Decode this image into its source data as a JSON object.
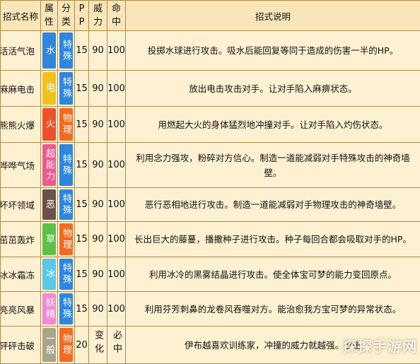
{
  "headers": {
    "name": "招式名称",
    "type": [
      "属",
      "性"
    ],
    "cat": [
      "分",
      "类"
    ],
    "pp": [
      "P",
      "P"
    ],
    "power": [
      "威",
      "力"
    ],
    "acc": [
      "命",
      "中"
    ],
    "desc": "招式说明"
  },
  "rows": [
    {
      "name": "活活气泡",
      "type": "水",
      "cat": "特殊",
      "pp": "15",
      "power": "90",
      "acc": "100",
      "desc": "投掷水球进行攻击。吸水后能回复等同于造成的伤害一半的HP。"
    },
    {
      "name": "麻麻电击",
      "type": "电",
      "cat": "特殊",
      "pp": "15",
      "power": "90",
      "acc": "100",
      "desc": "放出电击攻击对手。让对手陷入麻痹状态。"
    },
    {
      "name": "熊熊火爆",
      "type": "火",
      "cat": "物理",
      "pp": "15",
      "power": "90",
      "acc": "100",
      "desc": "用燃起大火的身体猛烈地冲撞对手。让对手陷入灼伤状态。"
    },
    {
      "name": "哗哗气场",
      "type": "超能力",
      "cat": "特殊",
      "pp": "15",
      "power": "90",
      "acc": "100",
      "desc": "利用念力强攻，粉碎对方信心。制造一道能减弱对手特殊攻击的神奇墙壁。"
    },
    {
      "name": "坏坏领域",
      "type": "恶",
      "cat": "特殊",
      "pp": "15",
      "power": "90",
      "acc": "100",
      "desc": "恶行恶相地进行攻击。制造一道能减弱对手物理攻击的神奇墙壁。"
    },
    {
      "name": "茁茁轰炸",
      "type": "草",
      "cat": "物理",
      "pp": "15",
      "power": "90",
      "acc": "100",
      "desc": "长出巨大的藤蔓，播撒种子进行攻击。种子每回合都会吸取对手的HP。"
    },
    {
      "name": "冰冰霜冻",
      "type": "冰",
      "cat": "特殊",
      "pp": "15",
      "power": "90",
      "acc": "100",
      "desc": "利用冰冷的黑雾结晶进行攻击。使全体宝可梦的能力变回原点。"
    },
    {
      "name": "亮亮风暴",
      "type": "妖精",
      "cat": "特殊",
      "pp": "15",
      "power": "90",
      "acc": "100",
      "desc": "利用芬芳刺鼻的龙卷风吞噬对方。能治愈我方宝可梦的异常状态。"
    },
    {
      "name": "砰砰击破",
      "type": "一般",
      "cat": "物理",
      "pp": "20",
      "power": "变化",
      "acc": "必中",
      "desc": "伊布越喜欢训练家，冲撞的威力就越强。攻击"
    }
  ],
  "colors": {
    "水": "#2f86e0",
    "电": "#f2c21a",
    "火": "#ef4f2a",
    "超能力": "#ec5a90",
    "恶": "#6b5148",
    "草": "#5fc047",
    "冰": "#58c8e8",
    "妖精": "#f08ad6",
    "一般": "#a8a68a",
    "特殊": "#2f86e0",
    "物理": "#f26a22"
  },
  "watermark": "探探手游网"
}
